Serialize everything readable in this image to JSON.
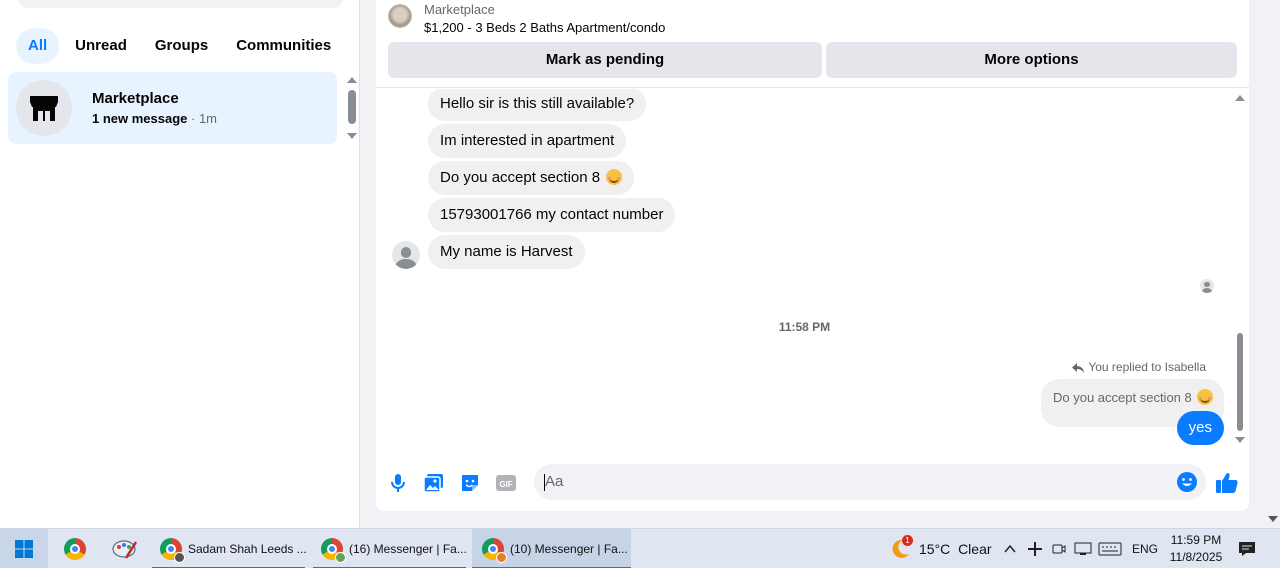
{
  "sidebar": {
    "filters": [
      "All",
      "Unread",
      "Groups",
      "Communities"
    ],
    "active_filter": "All",
    "conversation": {
      "name": "Marketplace",
      "unread": "1 new message",
      "separator": " · ",
      "time": "1m"
    }
  },
  "chat": {
    "listing": {
      "source": "Marketplace",
      "title": "$1,200 - 3 Beds 2 Baths Apartment/condo"
    },
    "buttons": {
      "pending": "Mark as pending",
      "more": "More options"
    },
    "incoming": [
      "Hello sir  is this still available?",
      "Im interested in apartment",
      "Do you accept section 8",
      "15793001766 my contact number",
      "My name is Harvest"
    ],
    "timestamp": "11:58 PM",
    "reply": {
      "label": "You replied to Isabella",
      "quoted": "Do you accept section 8",
      "text": "yes"
    },
    "composer": {
      "placeholder": "Aa"
    }
  },
  "taskbar": {
    "windows": [
      "Sadam Shah Leeds ...",
      "(16) Messenger | Fa...",
      "(10) Messenger | Fa..."
    ],
    "weather": {
      "temp": "15°C",
      "condition": "Clear",
      "alert_count": "1"
    },
    "language": "ENG",
    "time": "11:59 PM",
    "date": "11/8/2025"
  },
  "colors": {
    "accent": "#0a7cff",
    "bubble": "#f0f0f0",
    "active_chip_bg": "#e7f3ff"
  }
}
